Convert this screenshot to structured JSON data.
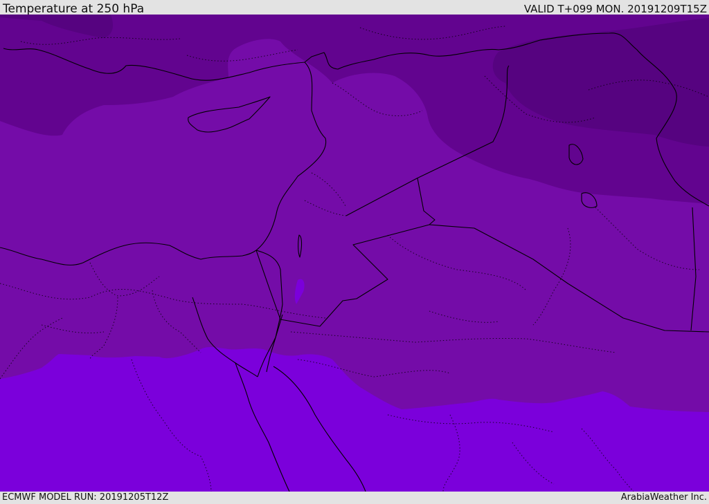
{
  "header": {
    "title": "Temperature at 250 hPa",
    "valid": "VALID T+099 MON. 20191209T15Z"
  },
  "footer": {
    "model_run": "ECMWF MODEL RUN: 20191205T12Z",
    "credit": "ArabiaWeather Inc."
  },
  "map": {
    "colors": {
      "coldest": "#560380",
      "colder": "#62048f",
      "cold": "#740ca8",
      "mild": "#7b00db",
      "border": "#000000"
    }
  }
}
